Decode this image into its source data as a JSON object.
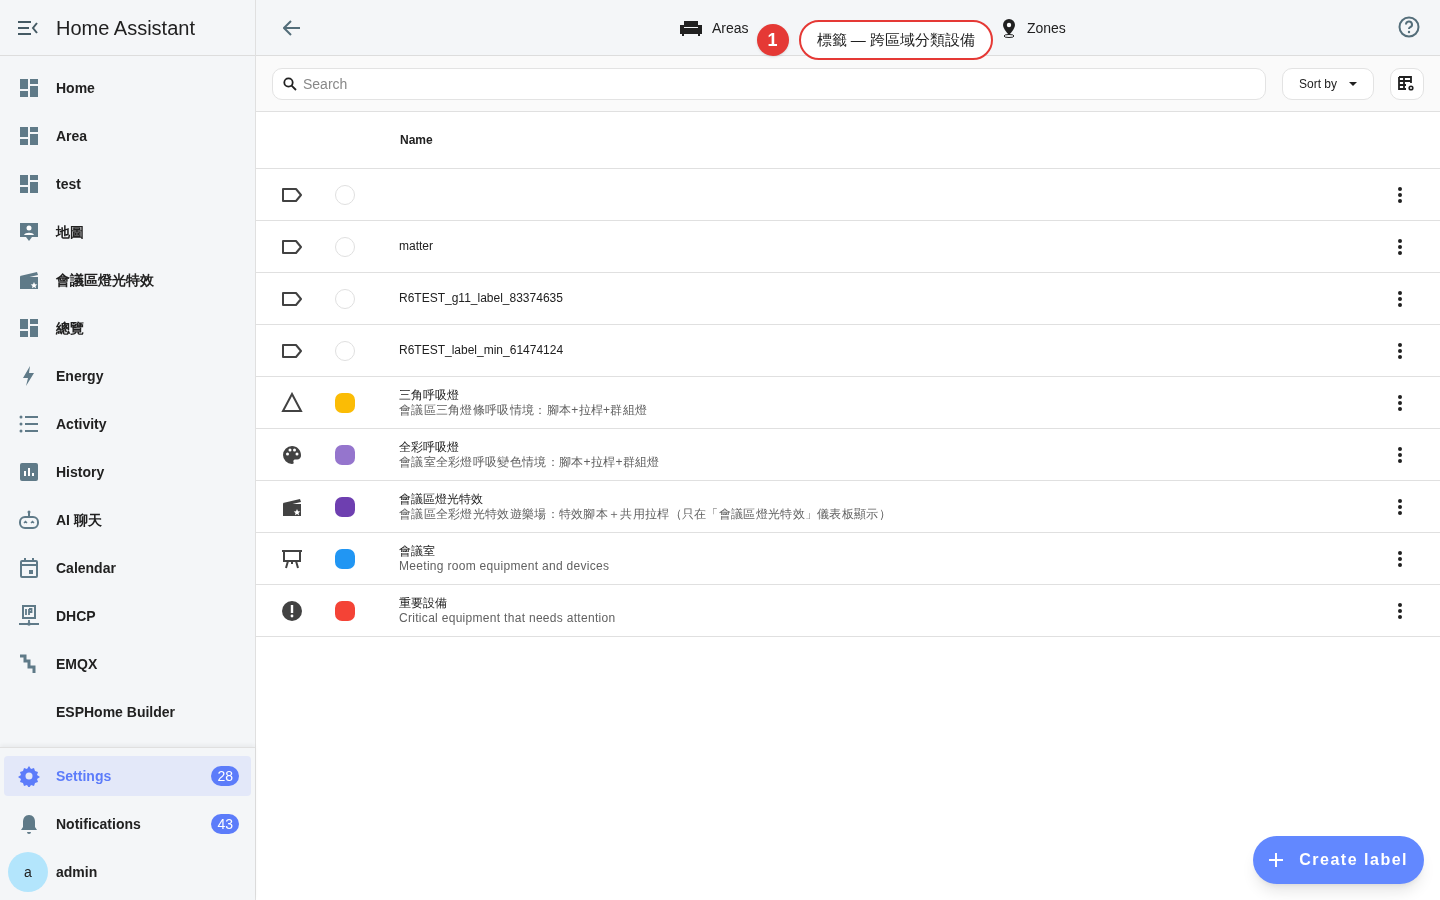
{
  "sidebar": {
    "title": "Home Assistant",
    "items": [
      {
        "label": "Home",
        "selected": false
      },
      {
        "label": "Area",
        "selected": false
      },
      {
        "label": "test",
        "selected": false
      },
      {
        "label": "地圖",
        "selected": false
      },
      {
        "label": "會議區燈光特效",
        "selected": false
      },
      {
        "label": "總覽",
        "selected": false
      },
      {
        "label": "Energy",
        "selected": false
      },
      {
        "label": "Activity",
        "selected": false
      },
      {
        "label": "History",
        "selected": false
      },
      {
        "label": "AI 聊天",
        "selected": false
      },
      {
        "label": "Calendar",
        "selected": false
      },
      {
        "label": "DHCP",
        "selected": false
      },
      {
        "label": "EMQX",
        "selected": false
      },
      {
        "label": "ESPHome Builder",
        "selected": false
      }
    ],
    "bottom": [
      {
        "label": "Settings",
        "badge": "28",
        "selected": true
      },
      {
        "label": "Notifications",
        "badge": "43",
        "selected": false
      }
    ],
    "user": {
      "initial": "a",
      "name": "admin"
    }
  },
  "tabs": [
    {
      "label": "Areas"
    },
    {
      "label": "Zones"
    }
  ],
  "callout": {
    "number": "1",
    "text": "標籤 — 跨區域分類設備"
  },
  "search": {
    "placeholder": "Search"
  },
  "sort_button": "Sort by",
  "table": {
    "columns": [
      "Name"
    ],
    "rows": [
      {},
      {
        "name": "matter"
      },
      {
        "name": "R6TEST_g11_label_83374635"
      },
      {
        "name": "R6TEST_label_min_61474124"
      },
      {
        "color": "#fbbc05",
        "name": "三角呼吸燈",
        "description": "會議區三角燈條呼吸情境：腳本+拉桿+群組燈"
      },
      {
        "color": "#9575cd",
        "name": "全彩呼吸燈",
        "description": "會議室全彩燈呼吸變色情境：腳本+拉桿+群組燈"
      },
      {
        "color": "#6e3fb0",
        "name": "會議區燈光特效",
        "description": "會議區全彩燈光特效遊樂場：特效腳本＋共用拉桿（只在「會議區燈光特效」儀表板顯示）"
      },
      {
        "color": "#2196f3",
        "name": "會議室",
        "description": "Meeting room equipment and devices"
      },
      {
        "color": "#f44336",
        "name": "重要設備",
        "description": "Critical equipment that needs attention"
      }
    ]
  },
  "fab": "Create label"
}
